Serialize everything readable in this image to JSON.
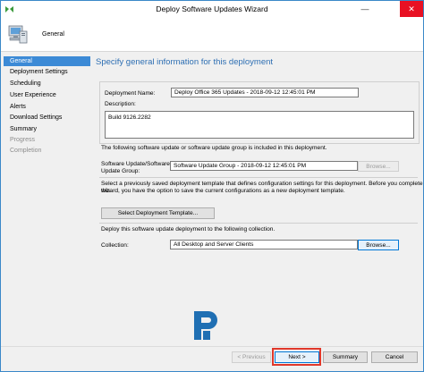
{
  "window": {
    "title": "Deploy Software Updates Wizard",
    "header_label": "General",
    "close_symbol": "✕",
    "minimize_symbol": "—"
  },
  "nav": {
    "items": [
      {
        "label": "General",
        "state": "active"
      },
      {
        "label": "Deployment Settings",
        "state": "normal"
      },
      {
        "label": "Scheduling",
        "state": "normal"
      },
      {
        "label": "User Experience",
        "state": "normal"
      },
      {
        "label": "Alerts",
        "state": "normal"
      },
      {
        "label": "Download Settings",
        "state": "normal"
      },
      {
        "label": "Summary",
        "state": "normal"
      },
      {
        "label": "Progress",
        "state": "disabled"
      },
      {
        "label": "Completion",
        "state": "disabled"
      }
    ]
  },
  "main": {
    "heading": "Specify general information for this deployment",
    "deployment_name_label": "Deployment Name:",
    "deployment_name_value": "Deploy Office 365 Updates - 2018-09-12 12:45:01 PM",
    "description_label": "Description:",
    "description_value": "Build 9126.2282",
    "update_info": "The following software update or software update group is included in this deployment.",
    "update_group_label_line1": "Software Update/Software",
    "update_group_label_line2": "Update Group:",
    "update_group_value": "Software Update Group - 2018-09-12 12:45:01 PM",
    "browse_label": "Browse...",
    "template_info_line1": "Select a previously saved deployment template that defines configuration settings for this deployment. Before you complete this",
    "template_info_line2": "wizard, you have the option to save the current configurations as a new deployment template.",
    "select_template_label": "Select Deployment Template...",
    "collection_info": "Deploy this software update deployment to the following collection.",
    "collection_label": "Collection:",
    "collection_value": "All Desktop and Server Clients",
    "collection_browse_label": "Browse..."
  },
  "footer": {
    "previous_label": "< Previous",
    "next_label": "Next >",
    "summary_label": "Summary",
    "cancel_label": "Cancel"
  },
  "colors": {
    "accent": "#3c8ad6",
    "heading": "#2e6fb3",
    "highlight": "#e0382b",
    "close_button": "#e81123"
  }
}
